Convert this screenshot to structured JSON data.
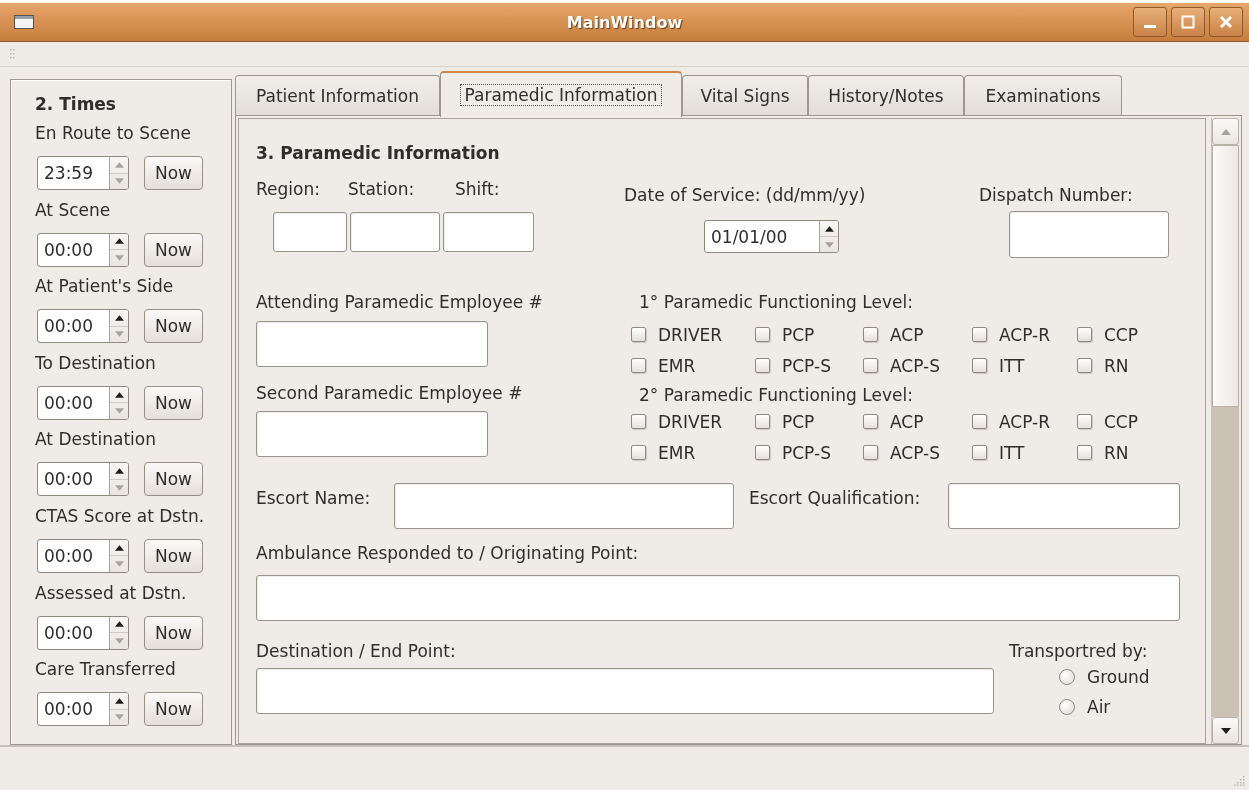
{
  "window": {
    "title": "MainWindow"
  },
  "times": {
    "heading": "2. Times",
    "entries": [
      {
        "label": "En Route to Scene",
        "value": "23:59",
        "up_enabled": false,
        "down_enabled": false,
        "button": "Now"
      },
      {
        "label": "At Scene",
        "value": "00:00",
        "up_enabled": true,
        "down_enabled": false,
        "button": "Now"
      },
      {
        "label": "At Patient's Side",
        "value": "00:00",
        "up_enabled": true,
        "down_enabled": false,
        "button": "Now"
      },
      {
        "label": "To Destination",
        "value": "00:00",
        "up_enabled": true,
        "down_enabled": false,
        "button": "Now"
      },
      {
        "label": "At Destination",
        "value": "00:00",
        "up_enabled": true,
        "down_enabled": false,
        "button": "Now"
      },
      {
        "label": "CTAS Score at Dstn.",
        "value": "00:00",
        "up_enabled": true,
        "down_enabled": false,
        "button": "Now"
      },
      {
        "label": "Assessed at Dstn.",
        "value": "00:00",
        "up_enabled": true,
        "down_enabled": false,
        "button": "Now"
      },
      {
        "label": "Care Transferred",
        "value": "00:00",
        "up_enabled": true,
        "down_enabled": false,
        "button": "Now"
      }
    ]
  },
  "tabs": [
    {
      "label": "Patient Information",
      "selected": false
    },
    {
      "label": "Paramedic Information",
      "selected": true
    },
    {
      "label": "Vital Signs",
      "selected": false
    },
    {
      "label": "History/Notes",
      "selected": false
    },
    {
      "label": "Examinations",
      "selected": false
    }
  ],
  "form": {
    "heading": "3. Paramedic Information",
    "region": {
      "label": "Region:"
    },
    "station": {
      "label": "Station:"
    },
    "shift": {
      "label": "Shift:"
    },
    "date_of_service": {
      "label": "Date of Service: (dd/mm/yy)",
      "value": "01/01/00",
      "up_enabled": true,
      "down_enabled": false
    },
    "dispatch_number": {
      "label": "Dispatch Number:"
    },
    "attending_employee": {
      "label": "Attending Paramedic Employee #"
    },
    "second_employee": {
      "label": "Second Paramedic Employee #"
    },
    "levels": [
      {
        "label": "1° Paramedic Functioning Level:",
        "options": [
          {
            "label": "DRIVER",
            "checked": false
          },
          {
            "label": "PCP",
            "checked": false
          },
          {
            "label": "ACP",
            "checked": false
          },
          {
            "label": "ACP-R",
            "checked": false
          },
          {
            "label": "CCP",
            "checked": false
          },
          {
            "label": "EMR",
            "checked": false
          },
          {
            "label": "PCP-S",
            "checked": false
          },
          {
            "label": "ACP-S",
            "checked": false
          },
          {
            "label": "ITT",
            "checked": false
          },
          {
            "label": "RN",
            "checked": false
          }
        ]
      },
      {
        "label": "2° Paramedic Functioning Level:",
        "options": [
          {
            "label": "DRIVER",
            "checked": false
          },
          {
            "label": "PCP",
            "checked": false
          },
          {
            "label": "ACP",
            "checked": false
          },
          {
            "label": "ACP-R",
            "checked": false
          },
          {
            "label": "CCP",
            "checked": false
          },
          {
            "label": "EMR",
            "checked": false
          },
          {
            "label": "PCP-S",
            "checked": false
          },
          {
            "label": "ACP-S",
            "checked": false
          },
          {
            "label": "ITT",
            "checked": false
          },
          {
            "label": "RN",
            "checked": false
          }
        ]
      }
    ],
    "escort_name": {
      "label": "Escort Name:"
    },
    "escort_qualification": {
      "label": "Escort Qualification:"
    },
    "origin": {
      "label": "Ambulance Responded to / Originating Point:"
    },
    "destination": {
      "label": "Destination / End Point:"
    },
    "transported_by": {
      "label": "Transportred by:",
      "options": [
        {
          "label": "Ground",
          "selected": false
        },
        {
          "label": "Air",
          "selected": false
        }
      ]
    }
  }
}
